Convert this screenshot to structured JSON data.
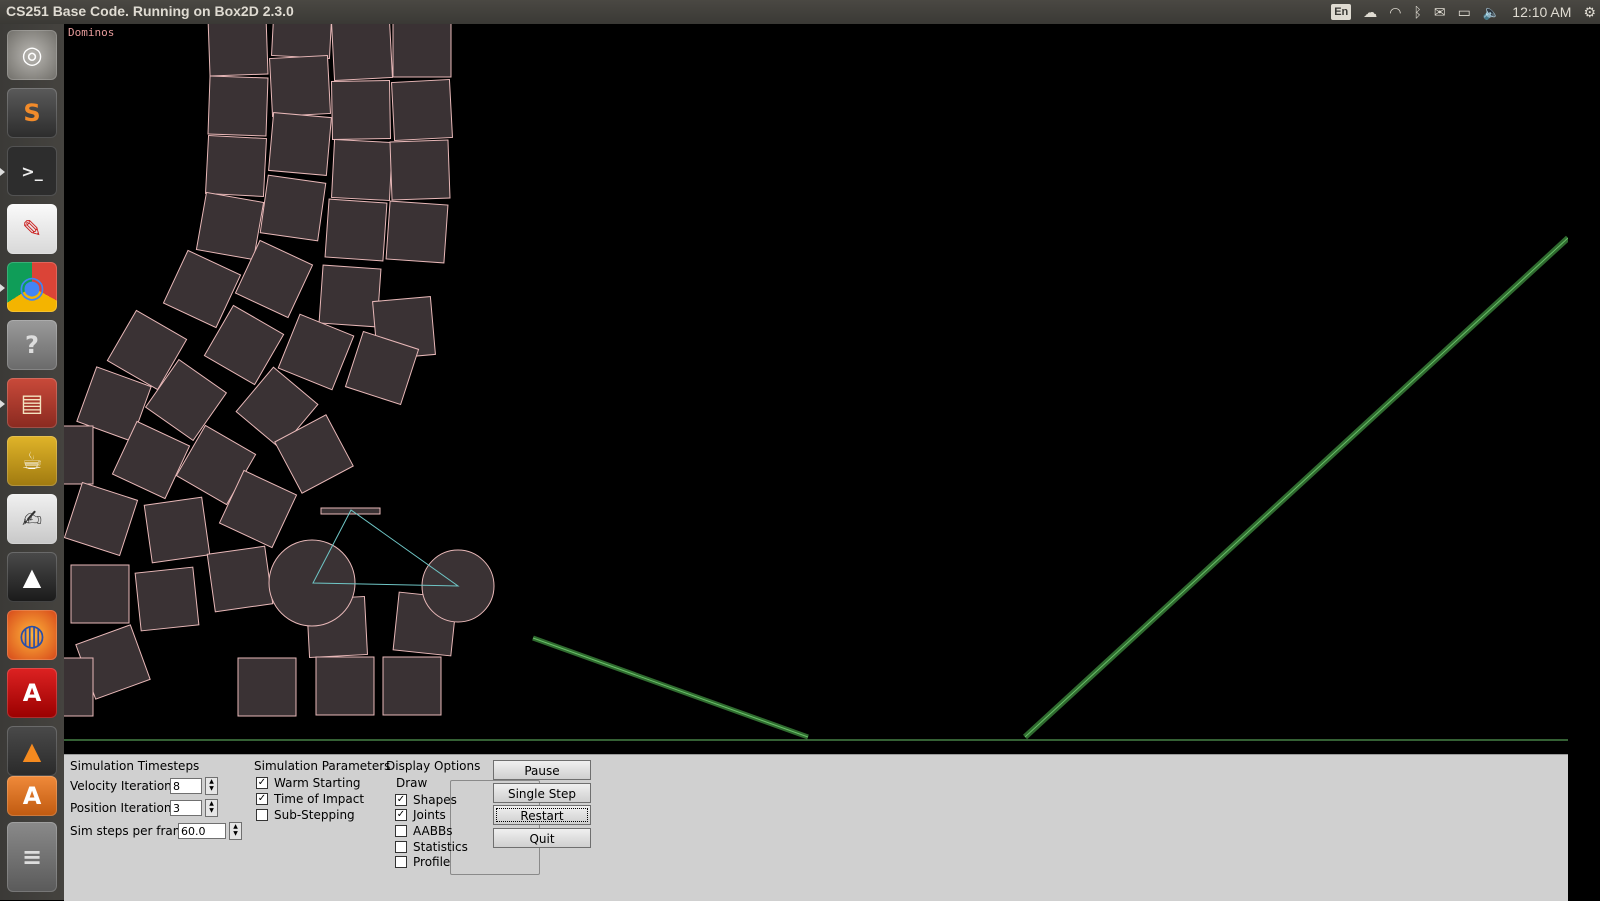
{
  "window": {
    "title": "CS251 Base Code. Running on Box2D 2.3.0"
  },
  "tray": {
    "language": "En",
    "clock": "12:10 AM"
  },
  "launcher": {
    "items": [
      {
        "name": "ubuntu-dash",
        "glyph": "◎"
      },
      {
        "name": "sublime-text",
        "glyph": "S"
      },
      {
        "name": "terminal",
        "glyph": ">_"
      },
      {
        "name": "document-viewer",
        "glyph": "✎"
      },
      {
        "name": "chrome",
        "glyph": "◉"
      },
      {
        "name": "help",
        "glyph": "?"
      },
      {
        "name": "archive-manager",
        "glyph": "▤"
      },
      {
        "name": "teapot-app",
        "glyph": "☕"
      },
      {
        "name": "text-editor",
        "glyph": "✍"
      },
      {
        "name": "inkscape",
        "glyph": "▲"
      },
      {
        "name": "firefox",
        "glyph": "◍"
      },
      {
        "name": "acrobat-reader",
        "glyph": "A"
      },
      {
        "name": "vlc",
        "glyph": "▲"
      },
      {
        "name": "software-center",
        "glyph": "A"
      },
      {
        "name": "workspaces",
        "glyph": "≡"
      }
    ]
  },
  "simulation": {
    "label": "Dominos"
  },
  "panel": {
    "timesteps": {
      "heading": "Simulation Timesteps",
      "velocity_label": "Velocity Iterations",
      "velocity_value": "8",
      "position_label": "Position Iterations",
      "position_value": "3",
      "steps_label": "Sim steps per frame",
      "steps_value": "60.0"
    },
    "parameters": {
      "heading": "Simulation Parameters",
      "warm_starting": "Warm Starting",
      "time_of_impact": "Time of Impact",
      "sub_stepping": "Sub-Stepping"
    },
    "display": {
      "heading": "Display Options",
      "draw_group": "Draw",
      "shapes": "Shapes",
      "joints": "Joints",
      "aabbs": "AABBs",
      "statistics": "Statistics",
      "profile": "Profile"
    },
    "buttons": {
      "pause": "Pause",
      "single_step": "Single Step",
      "restart": "Restart",
      "quit": "Quit"
    }
  },
  "colors": {
    "body_fill": "#3a3234",
    "body_stroke": "#e8b8b8",
    "static_stroke": "#69c069",
    "joint_stroke": "#6fc6c6",
    "launcher_bg": "#3b3a37",
    "panel_bg": "#d0d0d0"
  }
}
